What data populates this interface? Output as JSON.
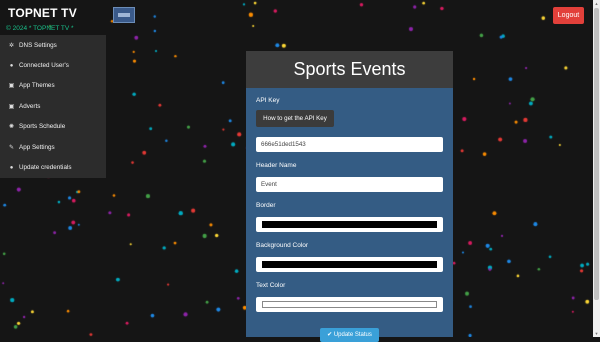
{
  "header": {
    "brand": "TOPNET TV",
    "copyright": "© 2024 * TOPNET TV *",
    "logout_label": "Logout"
  },
  "sidebar": {
    "items": [
      {
        "icon": "gears-icon",
        "glyph": "✲",
        "label": "DNS Settings"
      },
      {
        "icon": "user-icon",
        "glyph": "●",
        "label": "Connected User's"
      },
      {
        "icon": "image-icon",
        "glyph": "▣",
        "label": "App Themes"
      },
      {
        "icon": "image-icon",
        "glyph": "▣",
        "label": "Adverts"
      },
      {
        "icon": "gear-icon",
        "glyph": "✺",
        "label": "Sports Schedule"
      },
      {
        "icon": "wrench-icon",
        "glyph": "✎",
        "label": "App Settings"
      },
      {
        "icon": "user-icon",
        "glyph": "●",
        "label": "Update credentials"
      }
    ]
  },
  "panel": {
    "title": "Sports Events",
    "api_key_label": "API Key",
    "how_button": "How to get the API Key",
    "api_key_value": "666e51ded1543",
    "header_name_label": "Header Name",
    "header_name_value": "Event",
    "border_label": "Border",
    "border_color": "#000000",
    "bg_label": "Background Color",
    "bg_color": "#000000",
    "text_color_label": "Text Color",
    "text_color": "#ffffff",
    "update_button": "✔ Update Status"
  }
}
